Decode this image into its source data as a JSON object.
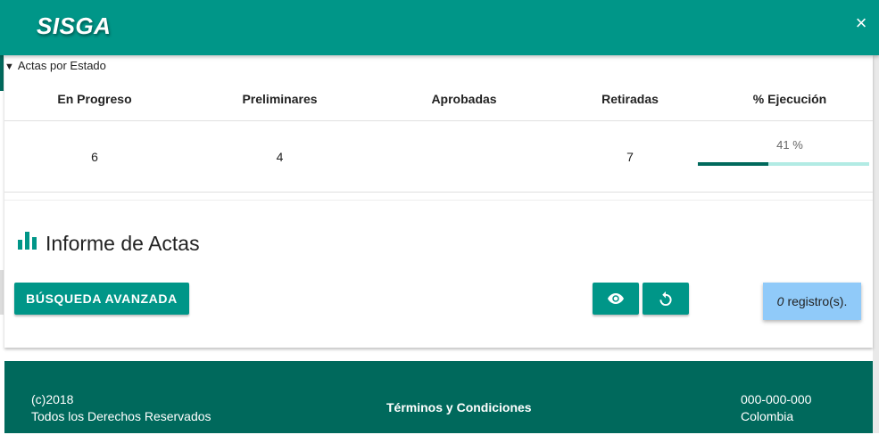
{
  "header": {
    "brand": "SISGA",
    "close_symbol": "×"
  },
  "summary": {
    "label": "Actas por Estado",
    "toggle_symbol": "▼"
  },
  "stats": {
    "headers": [
      "En Progreso",
      "Preliminares",
      "Aprobadas",
      "Retiradas",
      "% Ejecución"
    ],
    "values": [
      "6",
      "4",
      "",
      "7"
    ],
    "execution_percent": 41,
    "execution_label": "41 %"
  },
  "report": {
    "title": "Informe de Actas",
    "icon": "bar-chart-icon"
  },
  "actions": {
    "advanced_search_label": "BÚSQUEDA AVANZADA",
    "view_icon": "eye-icon",
    "reset_icon": "refresh-icon"
  },
  "records": {
    "count": "0",
    "suffix": "registro(s)."
  },
  "footer": {
    "copyright": "(c)2018",
    "rights": "Todos los Derechos Reservados",
    "terms": "Términos y Condiciones",
    "phone": "000-000-000",
    "country": "Colombia"
  },
  "colors": {
    "primary": "#009688",
    "dark": "#00695c",
    "progress_track": "#b2ebe4",
    "records_badge": "#90caf9"
  }
}
